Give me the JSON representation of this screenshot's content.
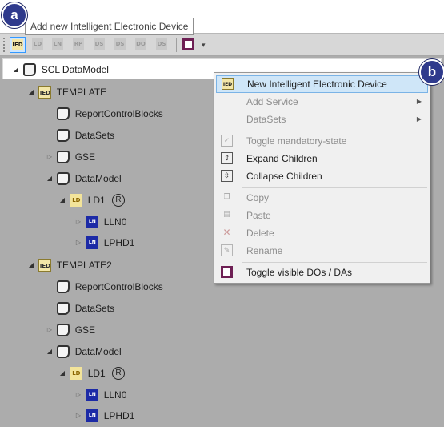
{
  "badges": {
    "a": "a",
    "b": "b"
  },
  "tooltip": {
    "text": "Add new Intelligent Electronic Device"
  },
  "toolbar": {
    "buttons": [
      {
        "icon": "IED",
        "name": "add-ied"
      },
      {
        "icon": "LD",
        "name": "add-ld"
      },
      {
        "icon": "LN",
        "name": "add-ln"
      },
      {
        "icon": "RP",
        "name": "add-rp"
      },
      {
        "icon": "DS",
        "name": "add-ds"
      },
      {
        "icon": "DS",
        "name": "add-ds2"
      },
      {
        "icon": "DO",
        "name": "add-do"
      },
      {
        "icon": "DS",
        "name": "add-ds3"
      }
    ],
    "overflow": "▾"
  },
  "tree": {
    "root": "SCL DataModel",
    "template": "TEMPLATE",
    "template_children": {
      "report_control_blocks": "ReportControlBlocks",
      "datasets": "DataSets",
      "gse": "GSE",
      "datamodel": "DataModel",
      "ld": "LD1",
      "ln0": "LLN0",
      "lphd": "LPHD1"
    },
    "template2": "TEMPLATE2",
    "template2_children": {
      "report_control_blocks": "ReportControlBlocks",
      "datasets": "DataSets",
      "gse": "GSE",
      "datamodel": "DataModel",
      "ld": "LD1",
      "ln0": "LLN0",
      "lphd": "LPHD1"
    },
    "r_mark": "R",
    "icons": {
      "ied": "IED",
      "ld": "LD",
      "ln": "LN"
    }
  },
  "menu": {
    "new_ied": "New Intelligent Electronic Device",
    "add_service": "Add Service",
    "datasets": "DataSets",
    "toggle_mandatory": "Toggle mandatory-state",
    "expand_children": "Expand Children",
    "collapse_children": "Collapse Children",
    "copy": "Copy",
    "paste": "Paste",
    "delete": "Delete",
    "rename": "Rename",
    "toggle_visible": "Toggle visible DOs / DAs"
  },
  "colors": {
    "badge": "#2f3a8c",
    "highlight": "#cfe6f8",
    "tree_bg": "#acacac",
    "ln_icon": "#1c2aa6"
  }
}
